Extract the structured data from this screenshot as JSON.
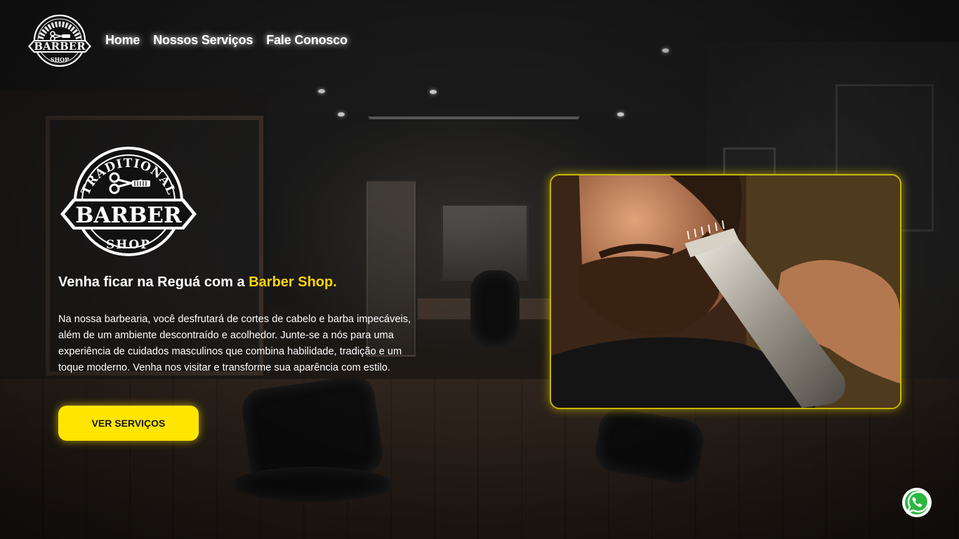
{
  "brand": {
    "logo_top_text": "TRADITIONAL",
    "logo_main_text": "BARBER",
    "logo_bottom_text": "SHOP"
  },
  "nav": {
    "items": [
      {
        "label": "Home"
      },
      {
        "label": "Nossos Serviços"
      },
      {
        "label": "Fale Conosco"
      }
    ]
  },
  "hero": {
    "tagline_prefix": "Venha ficar na Reguá com a ",
    "tagline_brand": "Barber Shop.",
    "description": "Na nossa barbearia, você desfrutará de cortes de cabelo e barba impecáveis, além de um ambiente descontraído e acolhedor. Junte-se a nós para uma experiência de cuidados masculinos que combina habilidade, tradição e um toque moderno. Venha nos visitar e transforme sua aparência com estilo.",
    "cta_label": "VER SERVIÇOS",
    "photo_subject": "man-beard-trim-photo"
  },
  "floating": {
    "whatsapp_icon": "whatsapp-icon"
  },
  "colors": {
    "accent": "#ffe600",
    "brand_text": "#ffd400",
    "photo_border": "#c8b800"
  }
}
